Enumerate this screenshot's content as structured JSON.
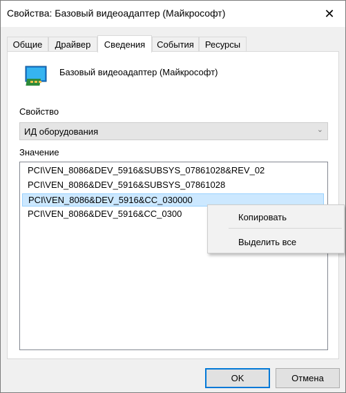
{
  "window": {
    "title": "Свойства: Базовый видеоадаптер (Майкрософт)",
    "close_glyph": "✕"
  },
  "tabs": [
    {
      "label": "Общие",
      "active": false
    },
    {
      "label": "Драйвер",
      "active": false
    },
    {
      "label": "Сведения",
      "active": true
    },
    {
      "label": "События",
      "active": false
    },
    {
      "label": "Ресурсы",
      "active": false
    }
  ],
  "device": {
    "name": "Базовый видеоадаптер (Майкрософт)",
    "icon": "display-adapter-icon"
  },
  "property": {
    "label": "Свойство",
    "selected": "ИД оборудования",
    "arrow_glyph": "⌄"
  },
  "value": {
    "label": "Значение",
    "items": [
      "PCI\\VEN_8086&DEV_5916&SUBSYS_07861028&REV_02",
      "PCI\\VEN_8086&DEV_5916&SUBSYS_07861028",
      "PCI\\VEN_8086&DEV_5916&CC_030000",
      "PCI\\VEN_8086&DEV_5916&CC_0300"
    ],
    "selected_index": 2
  },
  "context_menu": {
    "items": [
      "Копировать",
      "Выделить все"
    ]
  },
  "buttons": {
    "ok": "OK",
    "cancel": "Отмена"
  },
  "colors": {
    "selection": "#cce8ff",
    "accent": "#0078d7"
  }
}
